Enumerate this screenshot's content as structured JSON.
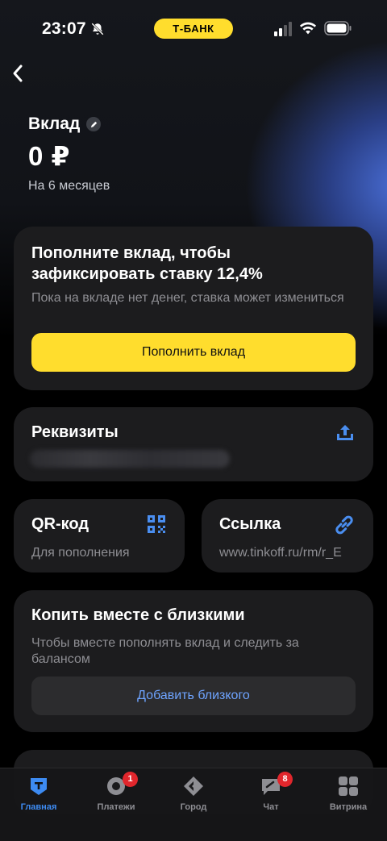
{
  "status_bar": {
    "time": "23:07",
    "carrier": "Т-БАНК",
    "icons": [
      "bell-off-icon",
      "signal-icon",
      "wifi-icon",
      "battery-icon"
    ]
  },
  "header": {
    "back_icon": "chevron-left-icon",
    "title": "Вклад",
    "edit_icon": "pencil-icon",
    "balance": "0 ₽",
    "term": "На 6 месяцев"
  },
  "topup_card": {
    "title": "Пополните вклад, чтобы зафиксировать ставку 12,4%",
    "text": "Пока на вкладе нет денег, ставка может измениться",
    "button_label": "Пополнить вклад"
  },
  "requisites_card": {
    "title": "Реквизиты",
    "icon": "share-icon"
  },
  "qr_card": {
    "title": "QR-код",
    "subtitle": "Для пополнения",
    "icon": "qr-code-icon"
  },
  "link_card": {
    "title": "Ссылка",
    "subtitle": "www.tinkoff.ru/rm/r_E",
    "icon": "link-icon"
  },
  "together_card": {
    "title": "Копить вместе с близкими",
    "text": "Чтобы вместе пополнять вклад и следить за балансом",
    "button_label": "Добавить близкого"
  },
  "tab_bar": {
    "tabs": [
      {
        "label": "Главная",
        "icon": "home-icon",
        "active": true
      },
      {
        "label": "Платежи",
        "icon": "payments-icon",
        "badge": "1"
      },
      {
        "label": "Город",
        "icon": "city-icon"
      },
      {
        "label": "Чат",
        "icon": "chat-icon",
        "badge": "8"
      },
      {
        "label": "Витрина",
        "icon": "showcase-icon"
      }
    ]
  },
  "colors": {
    "accent_yellow": "#ffdd2d",
    "link_blue": "#6ea4ff",
    "active_tab": "#3d8bf2",
    "badge_red": "#e1262c",
    "card_bg": "#1c1c1e"
  }
}
